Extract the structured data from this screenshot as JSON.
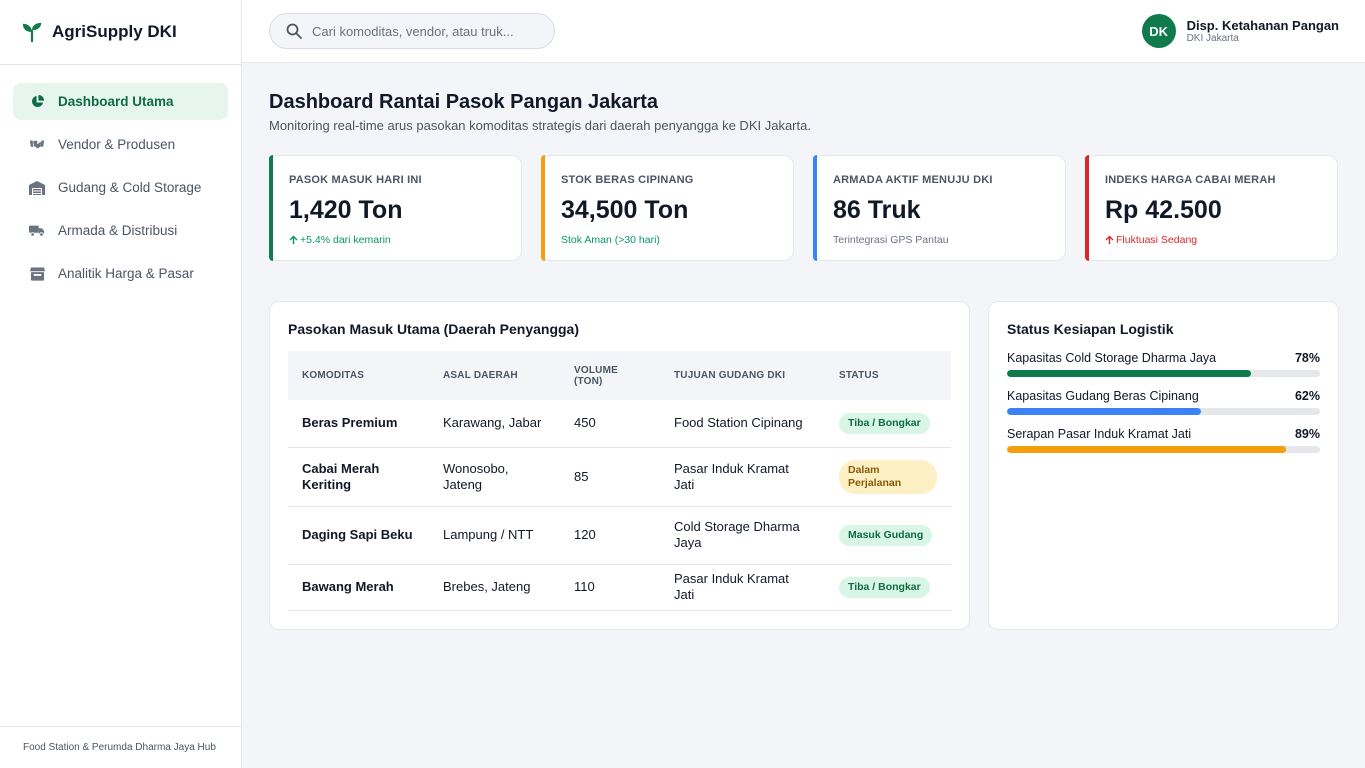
{
  "brand": {
    "name": "AgriSupply DKI",
    "icon": "sprout-icon",
    "color": "#0f7a4b"
  },
  "sidebar": {
    "items": [
      {
        "label": "Dashboard Utama",
        "icon": "pie-chart-icon",
        "active": true
      },
      {
        "label": "Vendor & Produsen",
        "icon": "handshake-icon",
        "active": false
      },
      {
        "label": "Gudang & Cold Storage",
        "icon": "warehouse-icon",
        "active": false
      },
      {
        "label": "Armada & Distribusi",
        "icon": "truck-icon",
        "active": false
      },
      {
        "label": "Analitik Harga & Pasar",
        "icon": "store-icon",
        "active": false
      }
    ],
    "footer": "Food Station & Perumda Dharma Jaya Hub"
  },
  "header": {
    "search_placeholder": "Cari komoditas, vendor, atau truk...",
    "user": {
      "initials": "DK",
      "name": "Disp. Ketahanan Pangan",
      "role": "DKI Jakarta"
    }
  },
  "page": {
    "title": "Dashboard Rantai Pasok Pangan Jakarta",
    "subtitle": "Monitoring real-time arus pasokan komoditas strategis dari daerah penyangga ke DKI Jakarta."
  },
  "kpis": [
    {
      "label": "PASOK MASUK HARI INI",
      "value": "1,420 Ton",
      "note": "+5.4% dari kemarin",
      "note_color": "#059669",
      "accent": "#0f7a4b",
      "arrow": true
    },
    {
      "label": "STOK BERAS CIPINANG",
      "value": "34,500 Ton",
      "note": "Stok Aman (>30 hari)",
      "note_color": "#059669",
      "accent": "#f59e0b",
      "arrow": false
    },
    {
      "label": "ARMADA AKTIF MENUJU DKI",
      "value": "86 Truk",
      "note": "Terintegrasi GPS Pantau",
      "note_color": "#6b7280",
      "accent": "#3b82f6",
      "arrow": false
    },
    {
      "label": "INDEKS HARGA CABAI MERAH",
      "value": "Rp 42.500",
      "note": "Fluktuasi Sedang",
      "note_color": "#dc2626",
      "accent": "#dc2626",
      "arrow": true
    }
  ],
  "supply_table": {
    "title": "Pasokan Masuk Utama (Daerah Penyangga)",
    "headers": [
      "KOMODITAS",
      "ASAL DAERAH",
      "VOLUME (TON)",
      "TUJUAN GUDANG DKI",
      "STATUS"
    ],
    "rows": [
      {
        "commodity": "Beras Premium",
        "origin": "Karawang, Jabar",
        "volume": "450",
        "destination": "Food Station Cipinang",
        "status": "Tiba / Bongkar",
        "status_type": "green"
      },
      {
        "commodity": "Cabai Merah Keriting",
        "origin": "Wonosobo, Jateng",
        "volume": "85",
        "destination": "Pasar Induk Kramat Jati",
        "status": "Dalam Perjalanan",
        "status_type": "amber"
      },
      {
        "commodity": "Daging Sapi Beku",
        "origin": "Lampung / NTT",
        "volume": "120",
        "destination": "Cold Storage Dharma Jaya",
        "status": "Masuk Gudang",
        "status_type": "green"
      },
      {
        "commodity": "Bawang Merah",
        "origin": "Brebes, Jateng",
        "volume": "110",
        "destination": "Pasar Induk Kramat Jati",
        "status": "Tiba / Bongkar",
        "status_type": "green"
      }
    ]
  },
  "logistics": {
    "title": "Status Kesiapan Logistik",
    "items": [
      {
        "label": "Kapasitas Cold Storage Dharma Jaya",
        "percent_text": "78%",
        "percent": 78,
        "color": "#0f7a4b"
      },
      {
        "label": "Kapasitas Gudang Beras Cipinang",
        "percent_text": "62%",
        "percent": 62,
        "color": "#3b82f6"
      },
      {
        "label": "Serapan Pasar Induk Kramat Jati",
        "percent_text": "89%",
        "percent": 89,
        "color": "#f59e0b"
      }
    ]
  }
}
